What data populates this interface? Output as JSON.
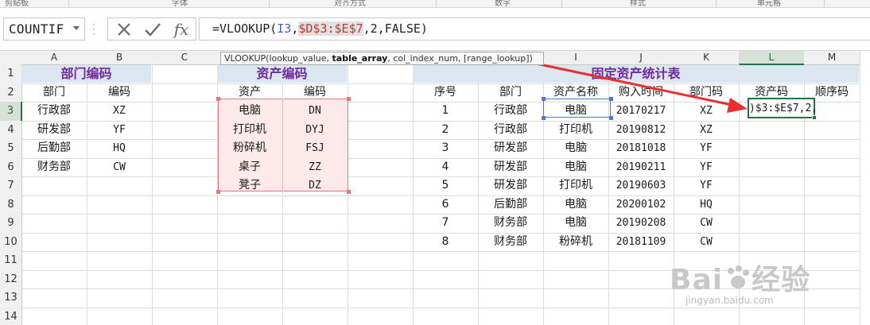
{
  "ribbon": {
    "groups": [
      "剪贴板",
      "字体",
      "对齐方式",
      "数字",
      "样式",
      "单元格"
    ]
  },
  "formula_bar": {
    "name_box": "COUNTIF",
    "cancel_icon": "x-icon",
    "enter_icon": "checkmark-icon",
    "fx_label": "fx",
    "formula_parts": [
      "=VLOOKUP(",
      "I3",
      ",",
      "$D$3:$E$7",
      ",2,FALSE)"
    ]
  },
  "tooltip": {
    "func": "VLOOKUP(lookup_value, ",
    "active_arg": "table_array",
    "rest": ", col_index_num, [range_lookup])"
  },
  "columns": [
    "A",
    "B",
    "C",
    "D",
    "E",
    "F",
    "G",
    "H",
    "I",
    "J",
    "K",
    "L",
    "M"
  ],
  "active_column": "L",
  "rows": [
    "1",
    "2",
    "3",
    "4",
    "5",
    "6",
    "7",
    "8",
    "9",
    "10",
    "11",
    "12",
    "13",
    "14"
  ],
  "active_row": "3",
  "dept_table": {
    "title": "部门编码",
    "headers": [
      "部门",
      "编码"
    ],
    "rows": [
      [
        "行政部",
        "XZ"
      ],
      [
        "研发部",
        "YF"
      ],
      [
        "后勤部",
        "HQ"
      ],
      [
        "财务部",
        "CW"
      ]
    ]
  },
  "asset_table": {
    "title": "资产编码",
    "headers": [
      "资产",
      "编码"
    ],
    "rows": [
      [
        "电脑",
        "DN"
      ],
      [
        "打印机",
        "DYJ"
      ],
      [
        "粉碎机",
        "FSJ"
      ],
      [
        "桌子",
        "ZZ"
      ],
      [
        "凳子",
        "DZ"
      ]
    ]
  },
  "stats_table": {
    "title": "固定资产统计表",
    "headers": [
      "序号",
      "部门",
      "资产名称",
      "购入时间",
      "部门码",
      "资产码",
      "顺序码"
    ],
    "rows": [
      [
        "1",
        "行政部",
        "电脑",
        "20170217",
        "XZ"
      ],
      [
        "2",
        "行政部",
        "打印机",
        "20190812",
        "XZ"
      ],
      [
        "3",
        "研发部",
        "电脑",
        "20181018",
        "YF"
      ],
      [
        "4",
        "研发部",
        "电脑",
        "20190211",
        "YF"
      ],
      [
        "5",
        "研发部",
        "打印机",
        "20190603",
        "YF"
      ],
      [
        "6",
        "后勤部",
        "电脑",
        "20200102",
        "HQ"
      ],
      [
        "7",
        "财务部",
        "电脑",
        "20190208",
        "CW"
      ],
      [
        "8",
        "财务部",
        "粉碎机",
        "20181109",
        "CW"
      ]
    ],
    "editing_cell_text": ")$3:$E$7,2,"
  },
  "colors": {
    "title_band": "#dce6f1",
    "title_text": "#6c2a9c",
    "range_fill": "#fde9e9",
    "range_border": "#e07a7a",
    "active_border": "#217346",
    "ref_blue": "#3a66c4",
    "arrow": "#e8312f"
  },
  "watermark": {
    "logo": "Bai",
    "logo_icon": "paw-icon",
    "logo_tail": "经验",
    "url": "jingyan.baidu.com"
  }
}
